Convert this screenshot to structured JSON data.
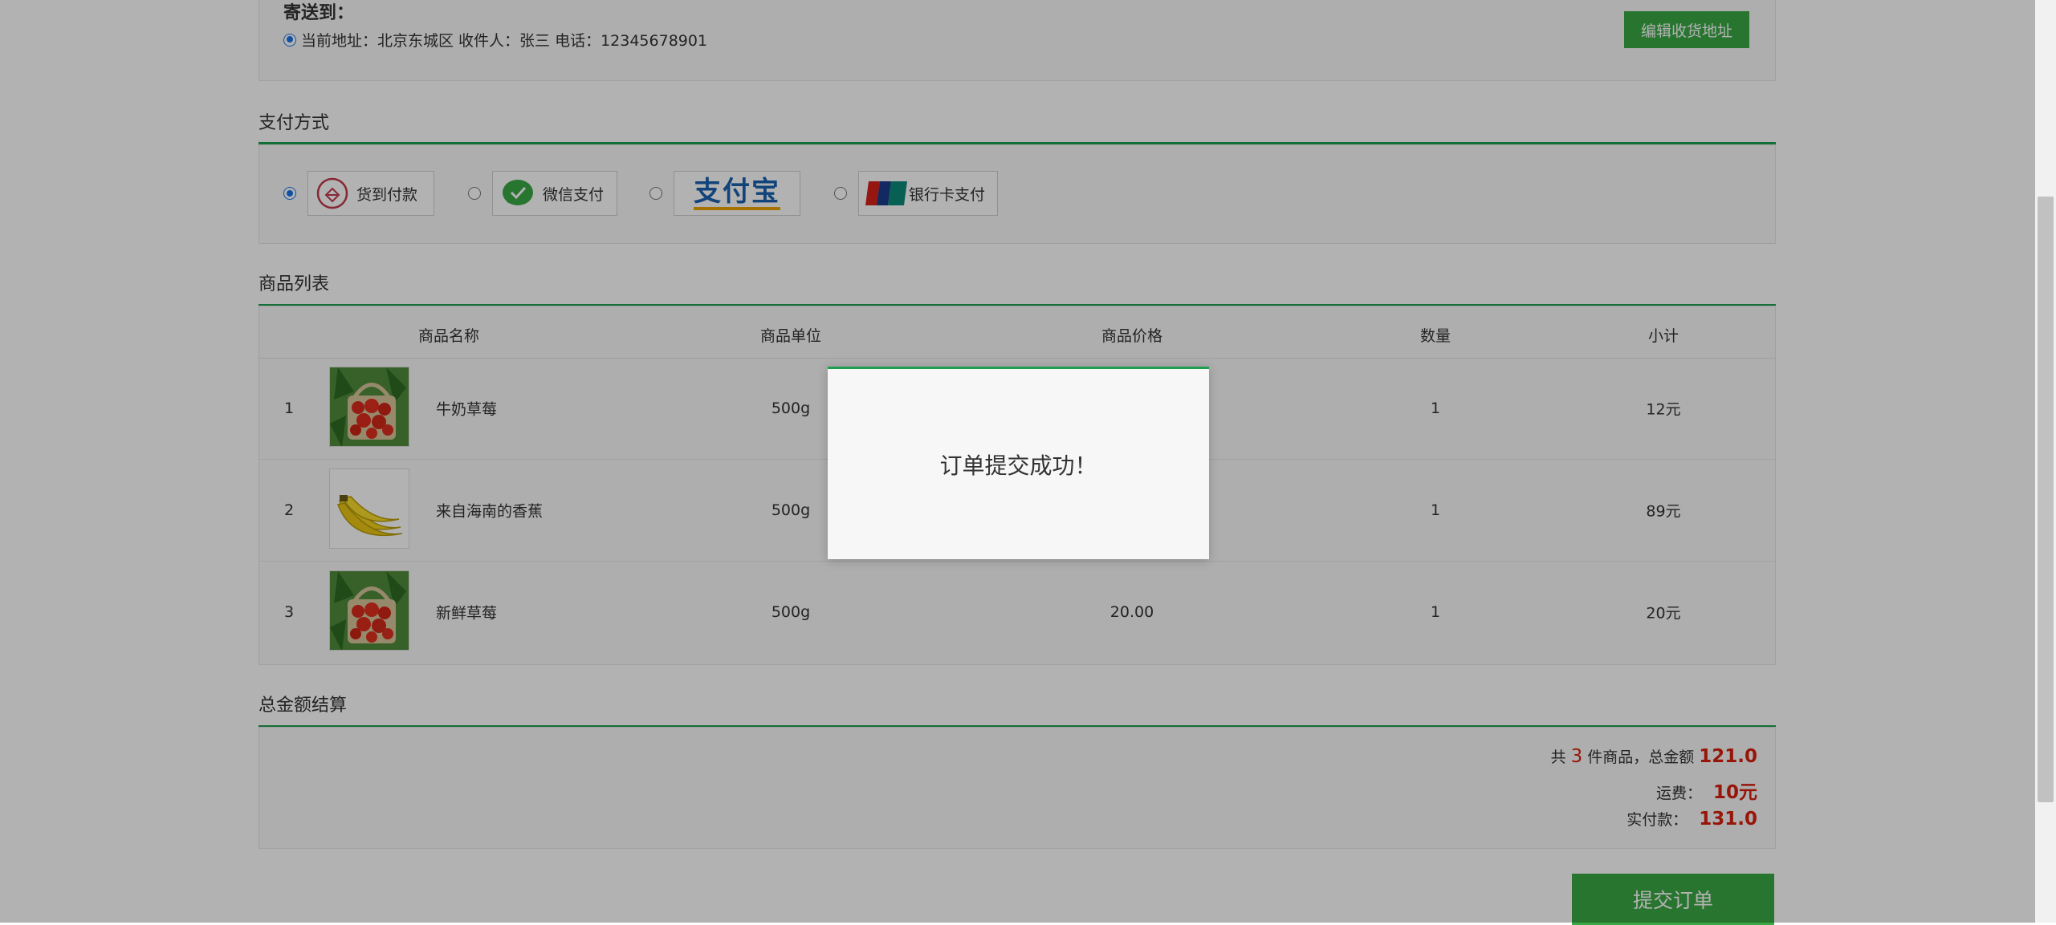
{
  "address": {
    "title": "寄送到：",
    "current": "当前地址：北京东城区 收件人：张三 电话：12345678901",
    "edit_button": "编辑收货地址"
  },
  "payment": {
    "title": "支付方式",
    "options": [
      {
        "label": "货到付款",
        "icon": "cash-on-delivery-icon",
        "selected": true
      },
      {
        "label": "微信支付",
        "icon": "wechat-pay-icon",
        "selected": false
      },
      {
        "label": "支付宝",
        "icon": "alipay-logo",
        "selected": false
      },
      {
        "label": "银行卡支付",
        "icon": "unionpay-icon",
        "selected": false
      }
    ],
    "unionpay_text": "UnionPay"
  },
  "products": {
    "title": "商品列表",
    "headers": [
      "商品名称",
      "商品单位",
      "商品价格",
      "数量",
      "小计"
    ],
    "rows": [
      {
        "index": "1",
        "name": "牛奶草莓",
        "unit": "500g",
        "price": "",
        "qty": "1",
        "subtotal": "12元",
        "image": "strawberry"
      },
      {
        "index": "2",
        "name": "来自海南的香蕉",
        "unit": "500g",
        "price": "",
        "qty": "1",
        "subtotal": "89元",
        "image": "banana"
      },
      {
        "index": "3",
        "name": "新鲜草莓",
        "unit": "500g",
        "price": "20.00",
        "qty": "1",
        "subtotal": "20元",
        "image": "strawberry"
      }
    ]
  },
  "total": {
    "title": "总金额结算",
    "count_prefix": "共",
    "count": "3",
    "count_suffix": "件商品，总金额",
    "amount": "121.0",
    "shipping_label": "运费：",
    "shipping": "10元",
    "paid_label": "实付款：",
    "paid": "131.0"
  },
  "submit_button": "提交订单",
  "dialog": {
    "message": "订单提交成功！"
  },
  "colors": {
    "accent_green": "#3aa845",
    "line_green": "#1e9e4f",
    "price_red": "#d9200e"
  }
}
